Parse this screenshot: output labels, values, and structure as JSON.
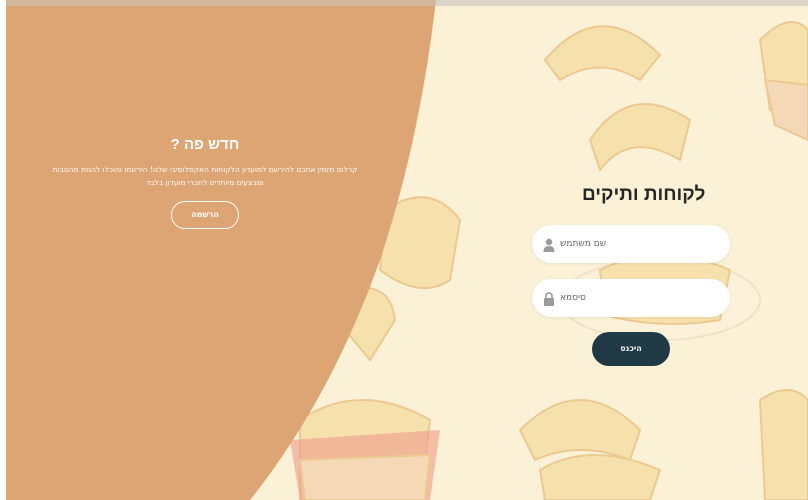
{
  "signup": {
    "title": "חדש פה ?",
    "text": "קרלוס מזמין אתכם להירשם למועדון הלקוחות האקסלוסיבי שלנו! הירשמו והוכלו להנות מהטבות ומבצעים מיוחדים לחברי מועדון בלבד",
    "button_label": "הרשמה"
  },
  "login": {
    "title": "לקוחות ותיקים",
    "username_placeholder": "שם משתמש",
    "password_placeholder": "סיסמא",
    "button_label": "היכנס"
  },
  "icons": {
    "username": "user-icon",
    "password": "lock-icon"
  },
  "colors": {
    "panel": "#dea574",
    "background": "#fbf1d6",
    "button_dark": "#1f3a45"
  }
}
